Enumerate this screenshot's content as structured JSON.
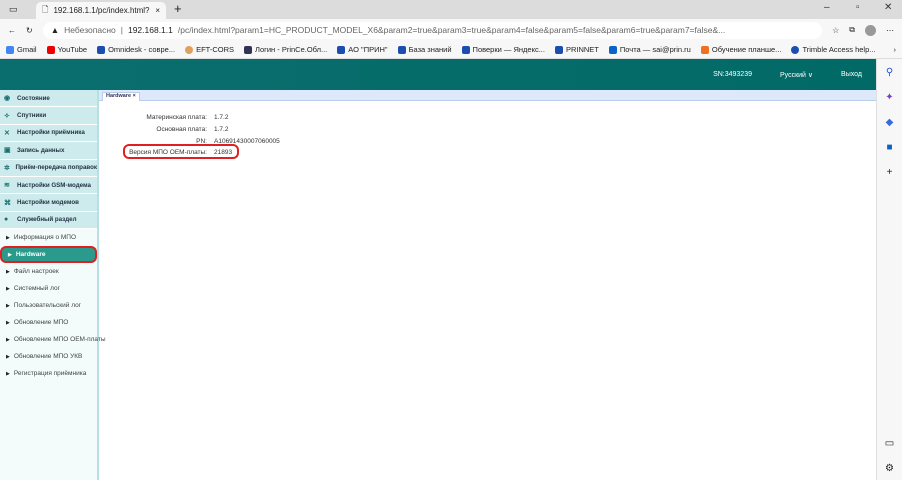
{
  "browser": {
    "tab_title": "192.168.1.1/pc/index.html?param",
    "security": "Небезопасно",
    "url_host": "192.168.1.1",
    "url_path": "/pc/index.html?param1=HC_PRODUCT_MODEL_X6&param2=true&param3=true&param4=false&param5=false&param6=true&param7=false&...",
    "bookmarks": [
      "Gmail",
      "YouTube",
      "Omnidesk - совре...",
      "EFT-CORS",
      "Логин - PrinCe.Обл...",
      "АО \"ПРИН\"",
      "База знаний",
      "Поверки — Яндекс...",
      "PRINNET",
      "Почта — sai@prin.ru",
      "Обучение планше...",
      "Trimble Access help..."
    ]
  },
  "header": {
    "sn": "SN:3493239",
    "language": "Русский",
    "logout": "Выход"
  },
  "sidebar": {
    "menu": [
      "Состояние",
      "Спутники",
      "Настройки приёмника",
      "Запись данных",
      "Приём-передача поправок",
      "Настройки GSM-модема",
      "Настройки модемов",
      "Служебный раздел"
    ],
    "submenu": [
      "Информация о МПО",
      "Hardware",
      "Файл настроек",
      "Системный лог",
      "Пользовательский лог",
      "Обновление МПО",
      "Обновление МПО OEM-платы",
      "Обновление МПО УКВ",
      "Регистрация приёмника"
    ]
  },
  "content": {
    "tab": "Hardware ×",
    "rows": [
      {
        "label": "Материнская плата:",
        "value": "1.7.2"
      },
      {
        "label": "Основная плата:",
        "value": "1.7.2"
      },
      {
        "label": "PN:",
        "value": "A10691430007060005"
      },
      {
        "label": "Версия МПО OEM-платы:",
        "value": "21893"
      }
    ]
  }
}
